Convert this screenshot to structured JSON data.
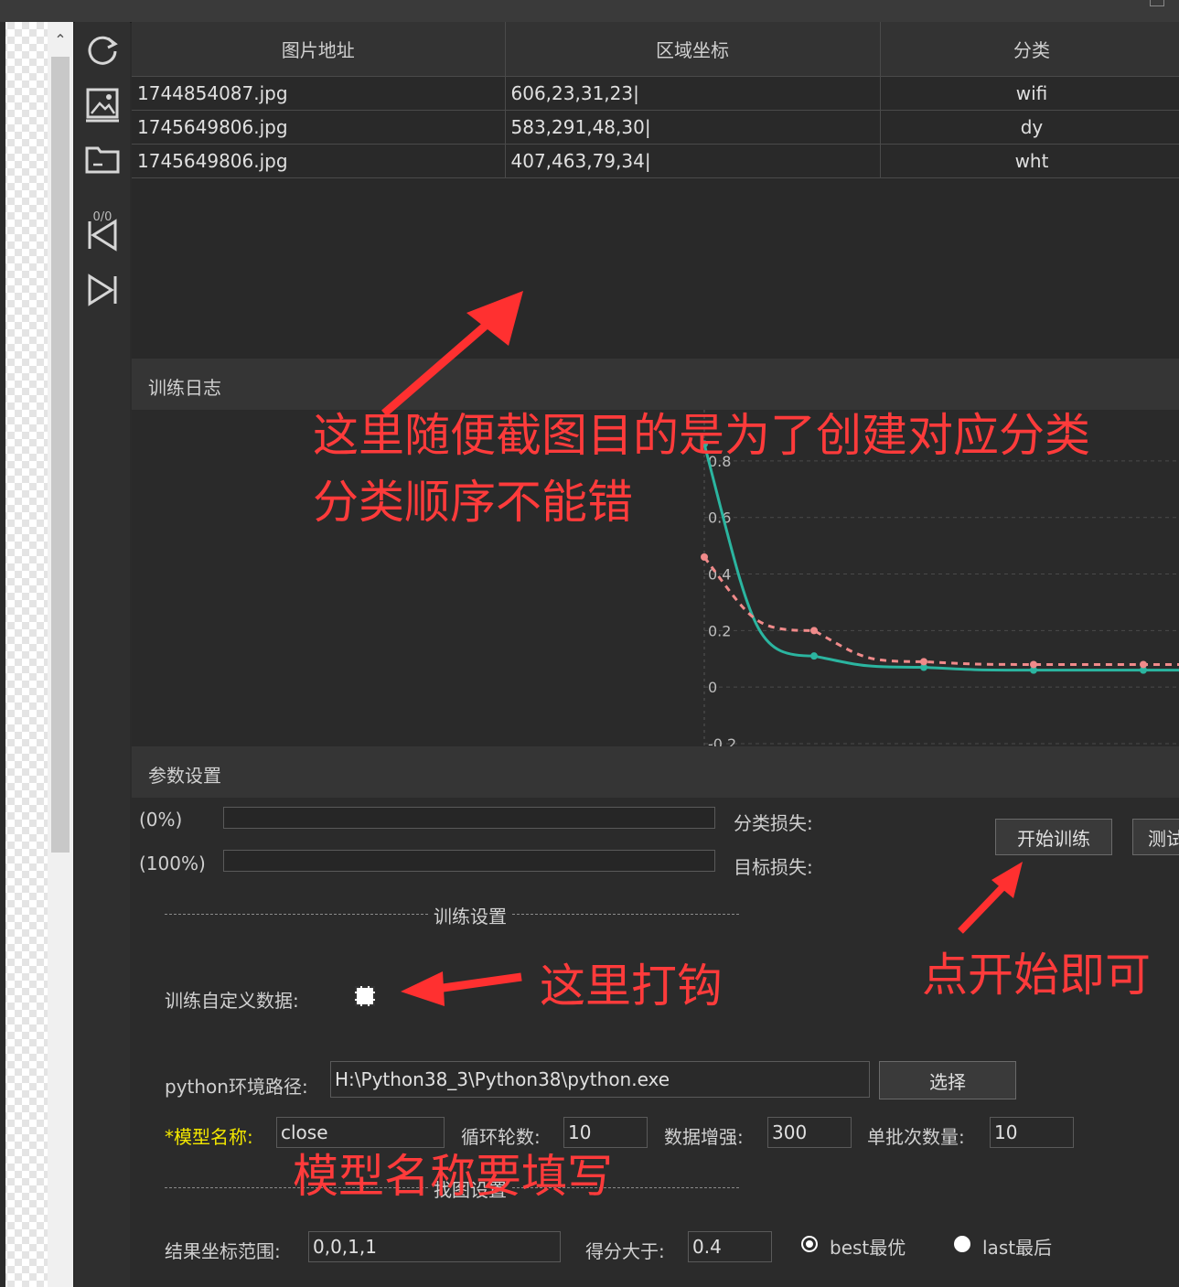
{
  "toolbar": {
    "counter": "0/0",
    "icons": [
      "refresh-icon",
      "image-icon",
      "folder-icon",
      "previous-icon",
      "next-icon"
    ]
  },
  "table": {
    "headers": [
      "图片地址",
      "区域坐标",
      "分类"
    ],
    "rows": [
      [
        "1744854087.jpg",
        "606,23,31,23|",
        "wifi"
      ],
      [
        "1745649806.jpg",
        "583,291,48,30|",
        "dy"
      ],
      [
        "1745649806.jpg",
        "407,463,79,34|",
        "wht"
      ]
    ]
  },
  "log": {
    "title": "训练日志"
  },
  "chart_data": {
    "type": "line",
    "ytick_labels": [
      "0.8",
      "0.6",
      "0.4",
      "0.2",
      "0",
      "-0.2"
    ],
    "ylim": [
      -0.2,
      0.9
    ],
    "grid": true,
    "series": [
      {
        "style": "solid",
        "color": "#2bb5a0",
        "x": [
          0,
          1,
          2,
          3,
          4
        ],
        "values": [
          0.86,
          0.11,
          0.07,
          0.06,
          0.06
        ]
      },
      {
        "style": "dashed",
        "color": "#f08a8a",
        "x": [
          0,
          1,
          2,
          3,
          4
        ],
        "values": [
          0.46,
          0.2,
          0.09,
          0.08,
          0.08
        ]
      }
    ]
  },
  "params": {
    "title": "参数设置",
    "progress": [
      {
        "label": "(0%)",
        "value": 0
      },
      {
        "label": "(100%)",
        "value": 0
      }
    ],
    "class_loss_label": "分类损失:",
    "target_loss_label": "目标损失:",
    "start_button": "开始训练",
    "test_button": "测试",
    "train_settings_label": "训练设置",
    "custom_data_label": "训练自定义数据:",
    "python_path_label": "python环境路径:",
    "python_path_value": "H:\\Python38_3\\Python38\\python.exe",
    "select_button": "选择",
    "model_name_label": "*模型名称:",
    "model_name_value": "close",
    "epochs_label": "循环轮数:",
    "epochs_value": "10",
    "augment_label": "数据增强:",
    "augment_value": "300",
    "batch_label": "单批次数量:",
    "batch_value": "10",
    "find_settings_label": "找图设置",
    "result_range_label": "结果坐标范围:",
    "result_range_value": "0,0,1,1",
    "score_label": "得分大于:",
    "score_value": "0.4",
    "best_label": "best最优",
    "last_label": "last最后"
  },
  "annotations": {
    "note1_line1": "这里随便截图目的是为了创建对应分类",
    "note1_line2": "分类顺序不能错",
    "note2": "这里打钩",
    "note3": "点开始即可",
    "note4": "模型名称要填写"
  }
}
